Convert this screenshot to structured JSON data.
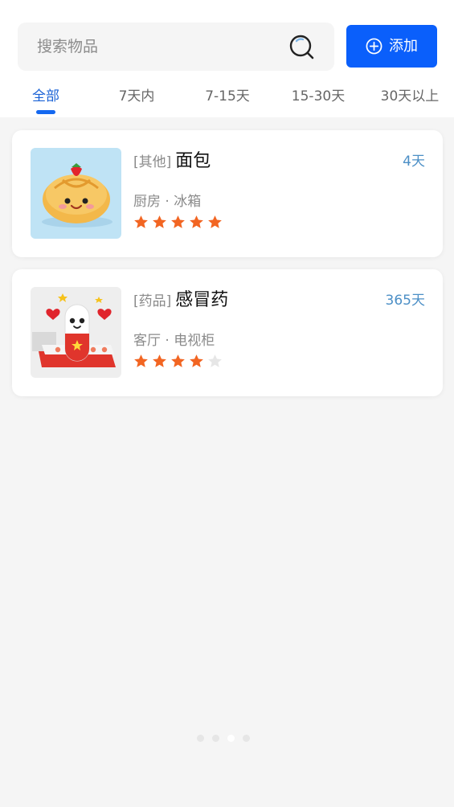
{
  "search": {
    "placeholder": "搜索物品"
  },
  "add_button": {
    "label": "添加"
  },
  "tabs": [
    {
      "label": "全部",
      "active": true
    },
    {
      "label": "7天内",
      "active": false
    },
    {
      "label": "7-15天",
      "active": false
    },
    {
      "label": "15-30天",
      "active": false
    },
    {
      "label": "30天以上",
      "active": false
    }
  ],
  "items": [
    {
      "category": "[其他]",
      "name": "面包",
      "days": "4天",
      "location": "厨房 · 冰箱",
      "rating": 5,
      "rating_max": 5,
      "image": "bread-with-strawberry-image"
    },
    {
      "category": "[药品]",
      "name": "感冒药",
      "days": "365天",
      "location": "客厅 · 电视柜",
      "rating": 4,
      "rating_max": 5,
      "image": "medicine-capsule-image"
    }
  ],
  "pagination": {
    "count": 4,
    "active": 3
  },
  "colors": {
    "accent": "#0a5ffb",
    "tab_active": "#1a62d6",
    "star_filled": "#f26522",
    "star_empty": "#e6e6e6",
    "days": "#4c8fc6"
  }
}
